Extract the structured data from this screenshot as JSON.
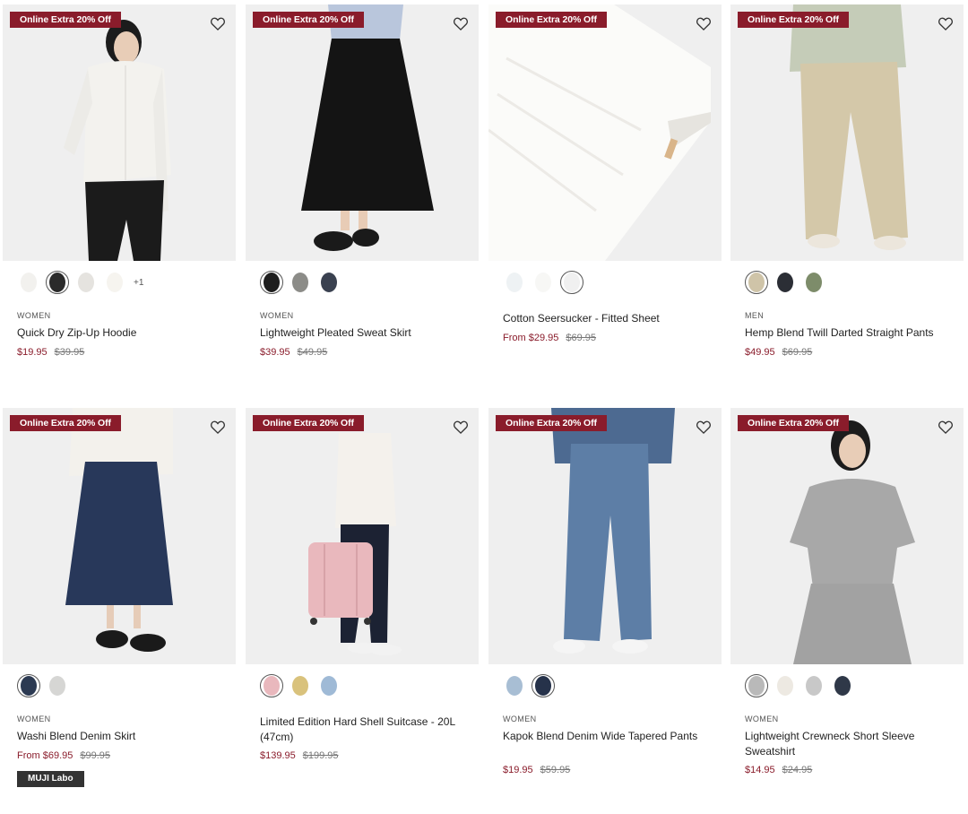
{
  "badge": "Online Extra 20% Off",
  "colors": {
    "accent": "#8a1c2b",
    "sale": "#8a1c2b"
  },
  "products": [
    {
      "category": "WOMEN",
      "name": "Quick Dry Zip-Up Hoodie",
      "sale": "$19.95",
      "original": "$39.95",
      "swatches": [
        "#f2f1ee",
        "#2a2a2a",
        "#e5e3df",
        "#f6f4ef"
      ],
      "more": "+1"
    },
    {
      "category": "WOMEN",
      "name": "Lightweight Pleated Sweat Skirt",
      "sale": "$39.95",
      "original": "$49.95",
      "swatches": [
        "#1d1d1d",
        "#8c8c88",
        "#3a4150"
      ]
    },
    {
      "category": "",
      "name": "Cotton Seersucker - Fitted Sheet",
      "sale": "From $29.95",
      "original": "$69.95",
      "swatches": [
        "#eef2f4",
        "#f7f7f5",
        "#f0f0f0"
      ]
    },
    {
      "category": "MEN",
      "name": "Hemp Blend Twill Darted Straight Pants",
      "sale": "$49.95",
      "original": "$69.95",
      "swatches": [
        "#cfc4a8",
        "#2b2e35",
        "#7d8c6a"
      ]
    },
    {
      "category": "WOMEN",
      "name": "Washi Blend Denim Skirt",
      "sale": "From $69.95",
      "original": "$99.95",
      "swatches": [
        "#2c3a52",
        "#d6d6d4"
      ],
      "tag": "MUJI Labo"
    },
    {
      "category": "",
      "name": "Limited Edition Hard Shell Suitcase - 20L (47cm)",
      "sale": "$139.95",
      "original": "$199.95",
      "swatches": [
        "#e9b8bd",
        "#d9c27c",
        "#9fbad6"
      ]
    },
    {
      "category": "WOMEN",
      "name": "Kapok Blend Denim Wide Tapered Pants",
      "sale": "$19.95",
      "original": "$59.95",
      "swatches": [
        "#a8bed4",
        "#26324a"
      ]
    },
    {
      "category": "WOMEN",
      "name": "Lightweight Crewneck Short Sleeve Sweatshirt",
      "sale": "$14.95",
      "original": "$24.95",
      "swatches": [
        "#b9b9b9",
        "#ede9e2",
        "#c8c8c8",
        "#2f3848"
      ]
    }
  ]
}
